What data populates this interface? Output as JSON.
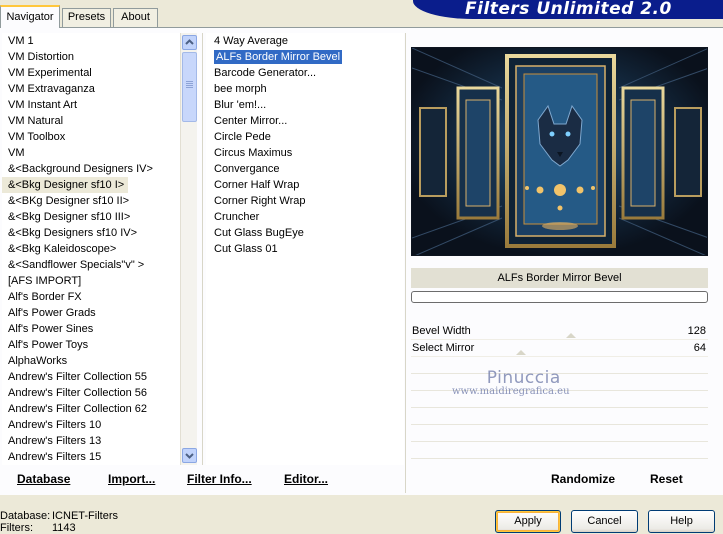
{
  "app": {
    "title": "Filters Unlimited 2.0"
  },
  "tabs": [
    {
      "label": "Navigator",
      "active": true
    },
    {
      "label": "Presets",
      "active": false
    },
    {
      "label": "About",
      "active": false
    }
  ],
  "categories": [
    "VM 1",
    "VM Distortion",
    "VM Experimental",
    "VM Extravaganza",
    "VM Instant Art",
    "VM Natural",
    "VM Toolbox",
    "VM",
    "&<Background Designers IV>",
    "&<Bkg Designer sf10 I>",
    "&<BKg Designer sf10 II>",
    "&<Bkg Designer sf10 III>",
    "&<Bkg Designers sf10 IV>",
    "&<Bkg Kaleidoscope>",
    "&<Sandflower Specials\"v\" >",
    "[AFS IMPORT]",
    "Alf's Border FX",
    "Alf's Power Grads",
    "Alf's Power Sines",
    "Alf's Power Toys",
    "AlphaWorks",
    "Andrew's Filter Collection 55",
    "Andrew's Filter Collection 56",
    "Andrew's Filter Collection 62",
    "Andrew's Filters 10",
    "Andrew's Filters 13",
    "Andrew's Filters 15"
  ],
  "selected_category": "&<Bkg Designer sf10 I>",
  "filters": [
    "4 Way Average",
    "ALFs Border Mirror Bevel",
    "Barcode Generator...",
    "bee morph",
    "Blur 'em!...",
    "Center Mirror...",
    "Circle Pede",
    "Circus Maximus",
    "Convergance",
    "Corner Half Wrap",
    "Corner Right Wrap",
    "Cruncher",
    "Cut Glass  BugEye",
    "Cut Glass 01"
  ],
  "selected_filter": "ALFs Border Mirror Bevel",
  "bottom_links": {
    "database": "Database",
    "import": "Import...",
    "filter_info": "Filter Info...",
    "editor": "Editor..."
  },
  "current_filter_name": "ALFs Border Mirror Bevel",
  "parameters": [
    {
      "name": "Bevel Width",
      "value": "128",
      "level": 128
    },
    {
      "name": "Select Mirror",
      "value": "64",
      "level": 64
    }
  ],
  "param_max": 255,
  "watermark": {
    "name": "Pinuccia",
    "url": "www.maidiregrafica.eu"
  },
  "preview_actions": {
    "randomize": "Randomize",
    "reset": "Reset"
  },
  "status": {
    "database_label": "Database:",
    "database_value": "ICNET-Filters",
    "filters_label": "Filters:",
    "filters_value": "1143"
  },
  "buttons": {
    "apply": "Apply",
    "cancel": "Cancel",
    "help": "Help"
  },
  "colors": {
    "banner": "#0a1d8c",
    "selection": "#316ac5",
    "tab_highlight": "#ffc73c"
  }
}
